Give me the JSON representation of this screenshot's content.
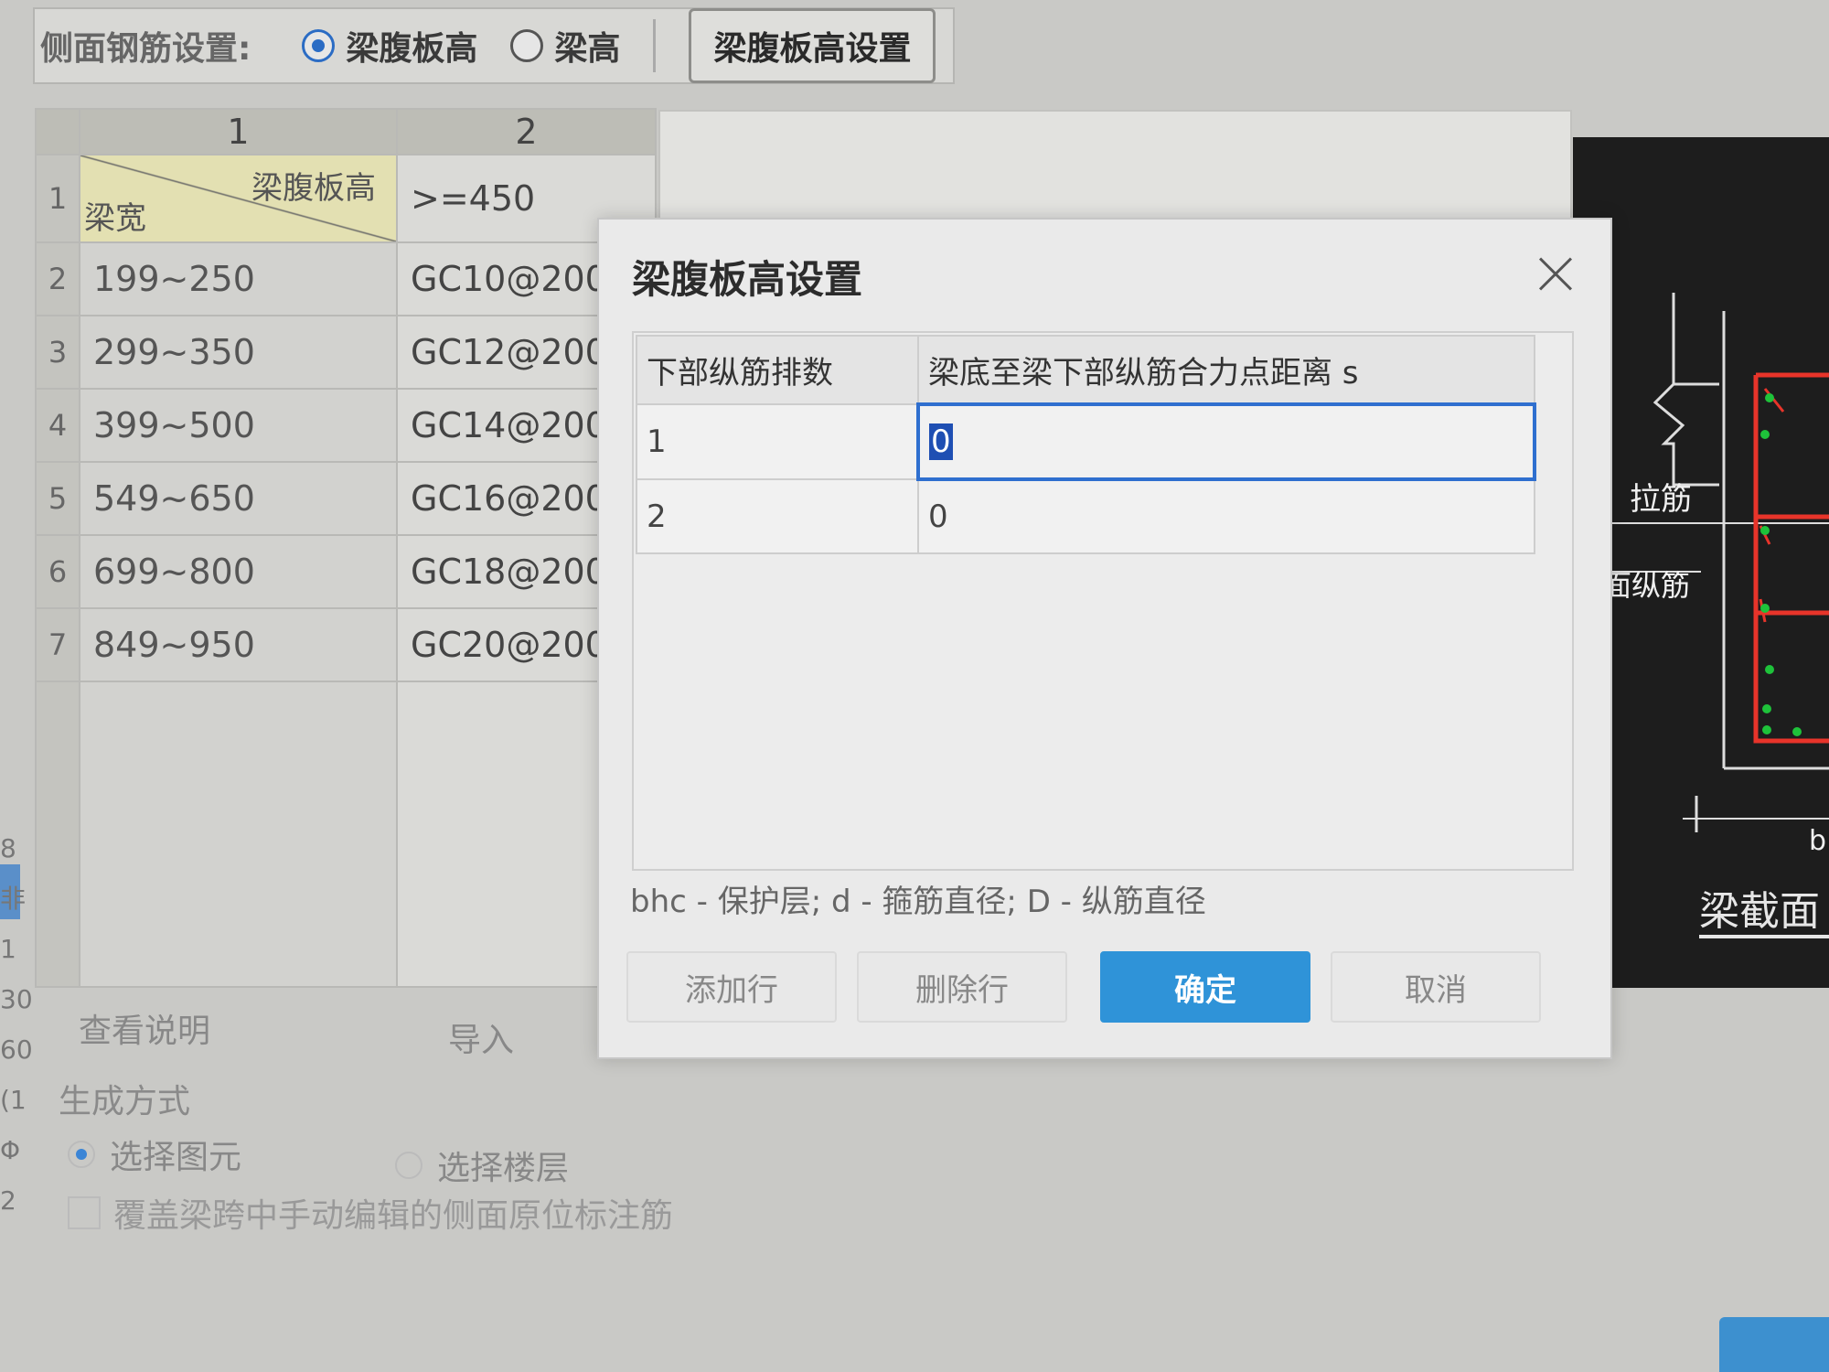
{
  "toolbar": {
    "label": "侧面钢筋设置:",
    "radio_web_height": "梁腹板高",
    "radio_beam_height": "梁高",
    "setting_button": "梁腹板高设置"
  },
  "grid": {
    "col_headers": [
      "1",
      "2"
    ],
    "header_row": {
      "rowno": "1",
      "top_right": "梁腹板高",
      "bottom_left": "梁宽",
      "col2": ">=450"
    },
    "rows": [
      {
        "rowno": "2",
        "width": "199~250",
        "rebar": "GC10@200"
      },
      {
        "rowno": "3",
        "width": "299~350",
        "rebar": "GC12@200"
      },
      {
        "rowno": "4",
        "width": "399~500",
        "rebar": "GC14@200"
      },
      {
        "rowno": "5",
        "width": "549~650",
        "rebar": "GC16@200"
      },
      {
        "rowno": "6",
        "width": "699~800",
        "rebar": "GC18@200"
      },
      {
        "rowno": "7",
        "width": "849~950",
        "rebar": "GC20@200"
      }
    ]
  },
  "background": {
    "view_desc_button": "查看说明",
    "import_button": "导入",
    "gen_mode_label": "生成方式",
    "option_select_element": "选择图元",
    "option_select_floor": "选择楼层",
    "override_checkbox": "覆盖梁跨中手动编辑的侧面原位标注筋",
    "edge_text": [
      "8",
      "非",
      "1",
      "30",
      "60",
      "(1",
      "Φ",
      "2"
    ]
  },
  "diagram": {
    "label_tie": "拉筋",
    "label_side_long": "侧面纵筋",
    "label_b": "b",
    "caption": "梁截面",
    "colors": {
      "rebar": "#e8342a",
      "dots": "#1ec23a",
      "lines": "#dddddd"
    }
  },
  "dialog": {
    "title": "梁腹板高设置",
    "col_rows": "下部纵筋排数",
    "col_distance": "梁底至梁下部纵筋合力点距离 s",
    "rows": [
      {
        "count": "1",
        "distance": "0"
      },
      {
        "count": "2",
        "distance": "0"
      }
    ],
    "note": "bhc - 保护层; d - 箍筋直径; D - 纵筋直径",
    "add_row": "添加行",
    "delete_row": "删除行",
    "ok": "确定",
    "cancel": "取消"
  },
  "colors": {
    "primary": "#2f93d8",
    "selection": "#2f6fcf"
  }
}
